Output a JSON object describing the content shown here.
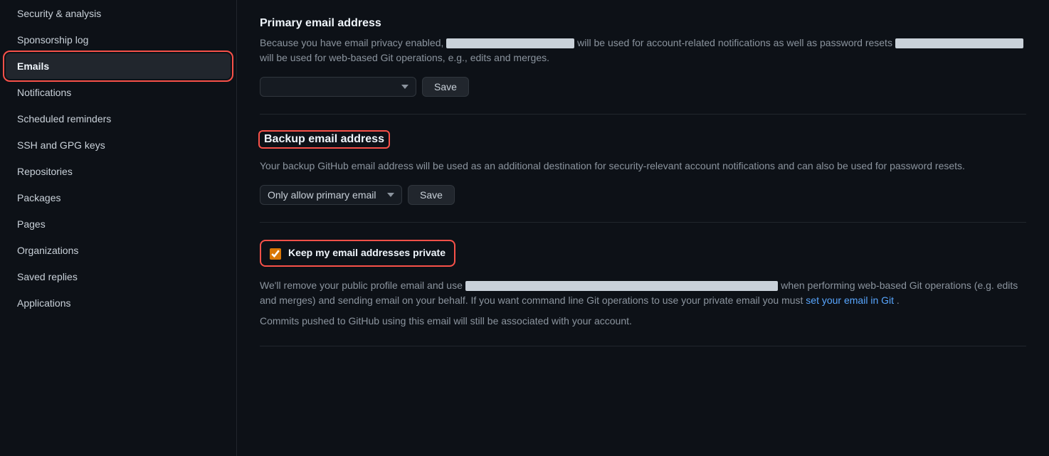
{
  "sidebar": {
    "items": [
      {
        "id": "security-analysis",
        "label": "Security & analysis",
        "active": false
      },
      {
        "id": "sponsorship-log",
        "label": "Sponsorship log",
        "active": false
      },
      {
        "id": "emails",
        "label": "Emails",
        "active": true
      },
      {
        "id": "notifications",
        "label": "Notifications",
        "active": false
      },
      {
        "id": "scheduled-reminders",
        "label": "Scheduled reminders",
        "active": false
      },
      {
        "id": "ssh-gpg-keys",
        "label": "SSH and GPG keys",
        "active": false
      },
      {
        "id": "repositories",
        "label": "Repositories",
        "active": false
      },
      {
        "id": "packages",
        "label": "Packages",
        "active": false
      },
      {
        "id": "pages",
        "label": "Pages",
        "active": false
      },
      {
        "id": "organizations",
        "label": "Organizations",
        "active": false
      },
      {
        "id": "saved-replies",
        "label": "Saved replies",
        "active": false
      },
      {
        "id": "applications",
        "label": "Applications",
        "active": false
      }
    ]
  },
  "main": {
    "primary_email": {
      "title": "Primary email address",
      "description_before": "Because you have email privacy enabled,",
      "description_middle": "will be used for account-related notifications as well as password resets",
      "description_after": "will be used for web-based Git operations, e.g., edits and merges.",
      "save_label": "Save",
      "select_placeholder": ""
    },
    "backup_email": {
      "title": "Backup email address",
      "description": "Your backup GitHub email address will be used as an additional destination for security-relevant account notifications and can also be used for password resets.",
      "select_option": "Only allow primary email",
      "save_label": "Save"
    },
    "privacy": {
      "checkbox_label": "Keep my email addresses private",
      "description_before": "We'll remove your public profile email and use",
      "description_after": "when performing web-based Git operations (e.g. edits and merges) and sending email on your behalf. If you want command line Git operations to use your private email you must",
      "link_text": "set your email in Git",
      "link_after": ".",
      "commits_desc": "Commits pushed to GitHub using this email will still be associated with your account."
    }
  }
}
